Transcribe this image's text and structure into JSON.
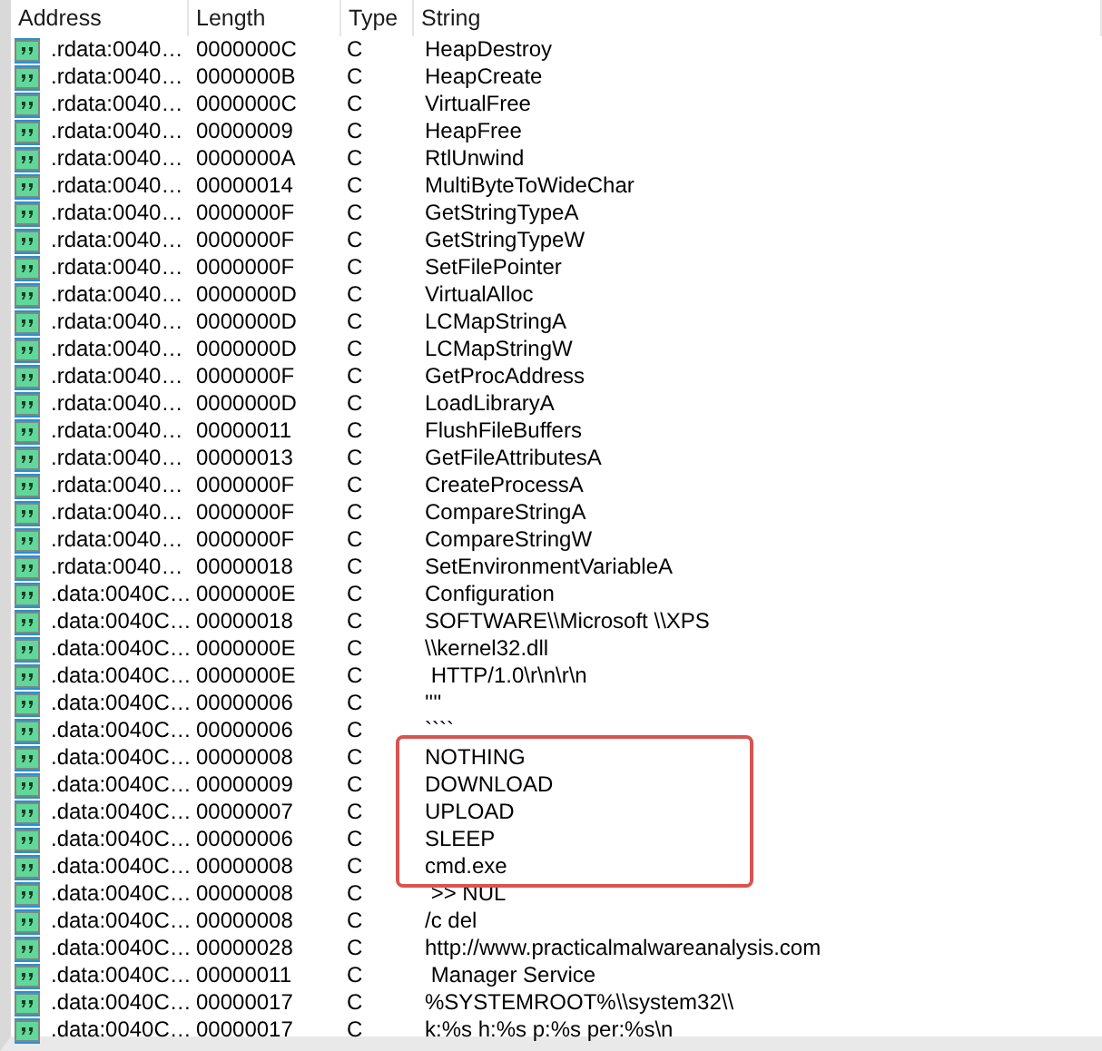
{
  "table": {
    "columns": [
      "Address",
      "Length",
      "Type",
      "String"
    ],
    "rows": [
      {
        "address": ".rdata:0040…",
        "length": "0000000C",
        "type": "C",
        "string": "HeapDestroy",
        "highlighted": false
      },
      {
        "address": ".rdata:0040…",
        "length": "0000000B",
        "type": "C",
        "string": "HeapCreate",
        "highlighted": false
      },
      {
        "address": ".rdata:0040…",
        "length": "0000000C",
        "type": "C",
        "string": "VirtualFree",
        "highlighted": false
      },
      {
        "address": ".rdata:0040…",
        "length": "00000009",
        "type": "C",
        "string": "HeapFree",
        "highlighted": false
      },
      {
        "address": ".rdata:0040…",
        "length": "0000000A",
        "type": "C",
        "string": "RtlUnwind",
        "highlighted": false
      },
      {
        "address": ".rdata:0040…",
        "length": "00000014",
        "type": "C",
        "string": "MultiByteToWideChar",
        "highlighted": false
      },
      {
        "address": ".rdata:0040…",
        "length": "0000000F",
        "type": "C",
        "string": "GetStringTypeA",
        "highlighted": false
      },
      {
        "address": ".rdata:0040…",
        "length": "0000000F",
        "type": "C",
        "string": "GetStringTypeW",
        "highlighted": false
      },
      {
        "address": ".rdata:0040…",
        "length": "0000000F",
        "type": "C",
        "string": "SetFilePointer",
        "highlighted": false
      },
      {
        "address": ".rdata:0040…",
        "length": "0000000D",
        "type": "C",
        "string": "VirtualAlloc",
        "highlighted": false
      },
      {
        "address": ".rdata:0040…",
        "length": "0000000D",
        "type": "C",
        "string": "LCMapStringA",
        "highlighted": false
      },
      {
        "address": ".rdata:0040…",
        "length": "0000000D",
        "type": "C",
        "string": "LCMapStringW",
        "highlighted": false
      },
      {
        "address": ".rdata:0040…",
        "length": "0000000F",
        "type": "C",
        "string": "GetProcAddress",
        "highlighted": false
      },
      {
        "address": ".rdata:0040…",
        "length": "0000000D",
        "type": "C",
        "string": "LoadLibraryA",
        "highlighted": false
      },
      {
        "address": ".rdata:0040…",
        "length": "00000011",
        "type": "C",
        "string": "FlushFileBuffers",
        "highlighted": false
      },
      {
        "address": ".rdata:0040…",
        "length": "00000013",
        "type": "C",
        "string": "GetFileAttributesA",
        "highlighted": false
      },
      {
        "address": ".rdata:0040…",
        "length": "0000000F",
        "type": "C",
        "string": "CreateProcessA",
        "highlighted": false
      },
      {
        "address": ".rdata:0040…",
        "length": "0000000F",
        "type": "C",
        "string": "CompareStringA",
        "highlighted": false
      },
      {
        "address": ".rdata:0040…",
        "length": "0000000F",
        "type": "C",
        "string": "CompareStringW",
        "highlighted": false
      },
      {
        "address": ".rdata:0040…",
        "length": "00000018",
        "type": "C",
        "string": "SetEnvironmentVariableA",
        "highlighted": false
      },
      {
        "address": ".data:0040C…",
        "length": "0000000E",
        "type": "C",
        "string": "Configuration",
        "highlighted": false
      },
      {
        "address": ".data:0040C…",
        "length": "00000018",
        "type": "C",
        "string": "SOFTWARE\\\\Microsoft \\\\XPS",
        "highlighted": false
      },
      {
        "address": ".data:0040C…",
        "length": "0000000E",
        "type": "C",
        "string": "\\\\kernel32.dll",
        "highlighted": false
      },
      {
        "address": ".data:0040C…",
        "length": "0000000E",
        "type": "C",
        "string": " HTTP/1.0\\r\\n\\r\\n",
        "highlighted": false
      },
      {
        "address": ".data:0040C…",
        "length": "00000006",
        "type": "C",
        "string": "''''",
        "highlighted": false
      },
      {
        "address": ".data:0040C…",
        "length": "00000006",
        "type": "C",
        "string": "````",
        "highlighted": false
      },
      {
        "address": ".data:0040C…",
        "length": "00000008",
        "type": "C",
        "string": "NOTHING",
        "highlighted": true
      },
      {
        "address": ".data:0040C…",
        "length": "00000009",
        "type": "C",
        "string": "DOWNLOAD",
        "highlighted": true
      },
      {
        "address": ".data:0040C…",
        "length": "00000007",
        "type": "C",
        "string": "UPLOAD",
        "highlighted": true
      },
      {
        "address": ".data:0040C…",
        "length": "00000006",
        "type": "C",
        "string": "SLEEP",
        "highlighted": true
      },
      {
        "address": ".data:0040C…",
        "length": "00000008",
        "type": "C",
        "string": "cmd.exe",
        "highlighted": true
      },
      {
        "address": ".data:0040C…",
        "length": "00000008",
        "type": "C",
        "string": " >> NUL",
        "highlighted": false
      },
      {
        "address": ".data:0040C…",
        "length": "00000008",
        "type": "C",
        "string": "/c del",
        "highlighted": false
      },
      {
        "address": ".data:0040C…",
        "length": "00000028",
        "type": "C",
        "string": "http://www.practicalmalwareanalysis.com",
        "highlighted": false
      },
      {
        "address": ".data:0040C…",
        "length": "00000011",
        "type": "C",
        "string": " Manager Service",
        "highlighted": false
      },
      {
        "address": ".data:0040C…",
        "length": "00000017",
        "type": "C",
        "string": "%SYSTEMROOT%\\\\system32\\\\",
        "highlighted": false
      },
      {
        "address": ".data:0040C…",
        "length": "00000017",
        "type": "C",
        "string": "k:%s h:%s p:%s per:%s\\n",
        "highlighted": false
      }
    ]
  }
}
